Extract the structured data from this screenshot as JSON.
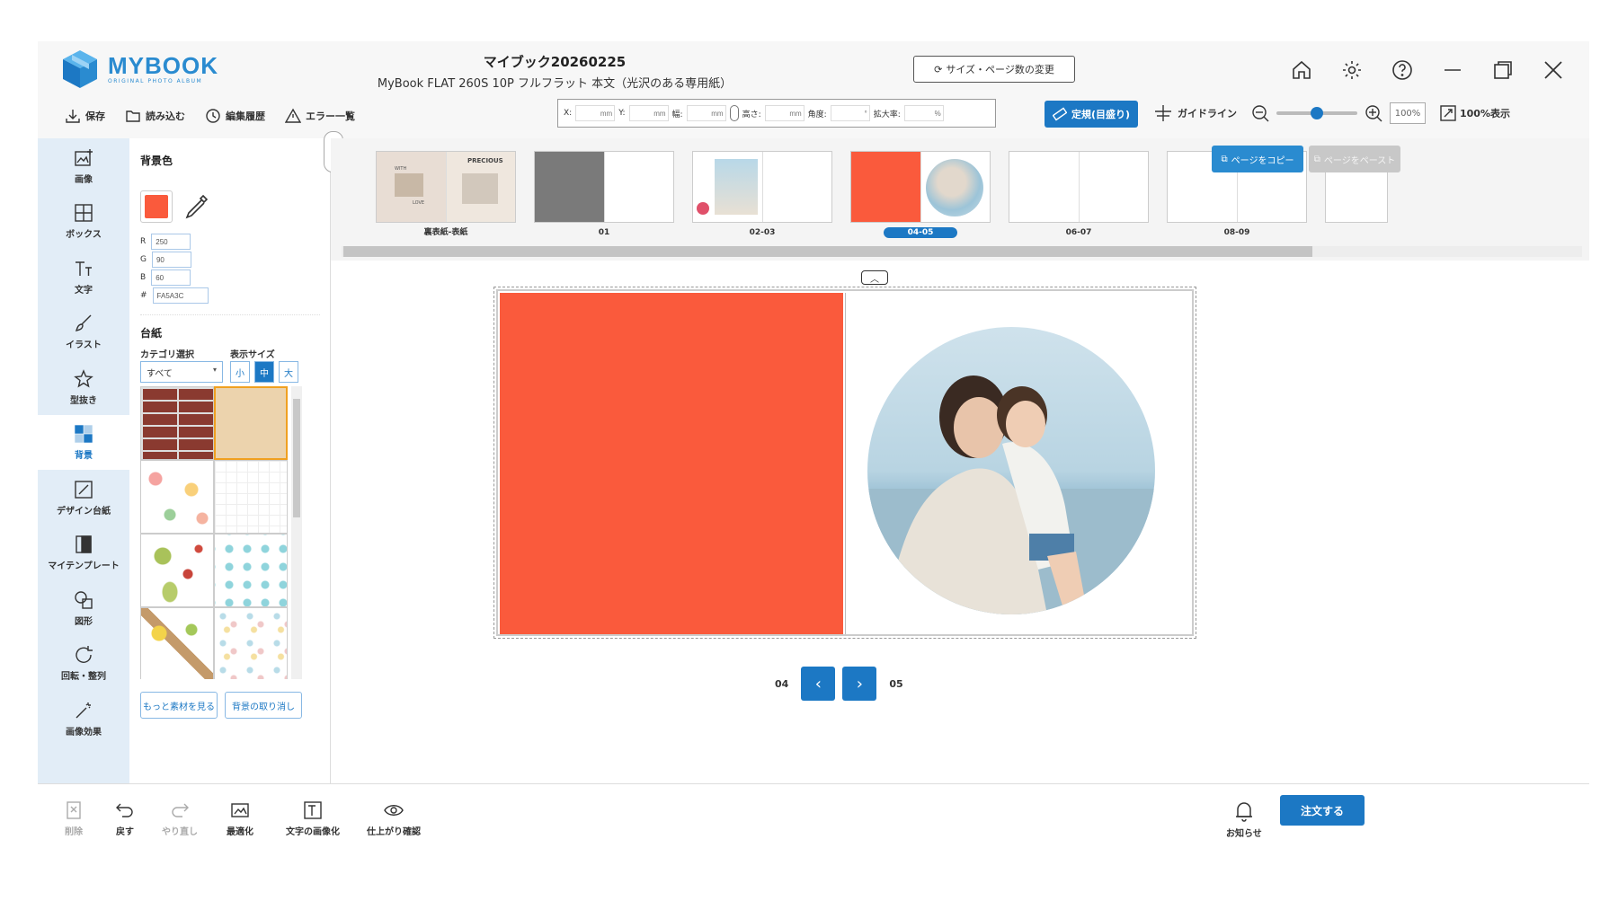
{
  "header": {
    "logo_text": "MYBOOK",
    "logo_sub": "ORIGINAL PHOTO ALBUM",
    "title": "マイブック20260225",
    "subtitle": "MyBook FLAT 260S 10P フルフラット 本文（光沢のある専用紙）",
    "size_change_label": "サイズ・ページ数の変更"
  },
  "toolbar": {
    "save": "保存",
    "load": "読み込む",
    "history": "編集履歴",
    "errors": "エラー一覧",
    "x_label": "X:",
    "y_label": "Y:",
    "w_label": "幅:",
    "h_label": "高さ:",
    "angle_label": "角度:",
    "scale_label": "拡大率:",
    "mm": "mm",
    "deg": "°",
    "pct": "%",
    "ruler": "定規(目盛り)",
    "guideline": "ガイドライン",
    "zoom_value": "100%",
    "zoom_level": 0.5,
    "zoom_100": "100%表示"
  },
  "tools": [
    {
      "label": "画像",
      "icon": "image-add-icon"
    },
    {
      "label": "ボックス",
      "icon": "box-layout-icon"
    },
    {
      "label": "文字",
      "icon": "text-icon"
    },
    {
      "label": "イラスト",
      "icon": "brush-icon"
    },
    {
      "label": "型抜き",
      "icon": "star-cutout-icon"
    },
    {
      "label": "背景",
      "icon": "background-checker-icon"
    },
    {
      "label": "デザイン台紙",
      "icon": "design-mount-icon"
    },
    {
      "label": "マイテンプレート",
      "icon": "template-icon"
    },
    {
      "label": "図形",
      "icon": "shapes-icon"
    },
    {
      "label": "回転・整列",
      "icon": "rotate-icon"
    },
    {
      "label": "画像効果",
      "icon": "magic-wand-icon"
    }
  ],
  "bg_panel": {
    "color_title": "背景色",
    "color_hex_value": "#FA5A3C",
    "r_label": "R",
    "r": "250",
    "g_label": "G",
    "g": "90",
    "b_label": "B",
    "b": "60",
    "hash_label": "#",
    "hex": "FA5A3C",
    "mount_title": "台紙",
    "category_label": "カテゴリ選択",
    "size_label": "表示サイズ",
    "category_value": "すべて",
    "size_small": "小",
    "size_medium": "中",
    "size_large": "大",
    "more_button": "もっと素材を見る",
    "cancel_bg_button": "背景の取り消し"
  },
  "pages": [
    {
      "label": "裏表紙-表紙"
    },
    {
      "label": "01"
    },
    {
      "label": "02-03"
    },
    {
      "label": "04-05",
      "active": true
    },
    {
      "label": "06-07"
    },
    {
      "label": "08-09"
    }
  ],
  "cover_text": {
    "precious": "PRECIOUS",
    "with": "WITH",
    "love": "LOVE"
  },
  "copy_page": "ページをコピー",
  "paste_page": "ページをペースト",
  "page_nav": {
    "left": "04",
    "right": "05"
  },
  "bottom": {
    "delete": "削除",
    "undo": "戻す",
    "redo": "やり直し",
    "optimize": "最適化",
    "text_to_image": "文字の画像化",
    "preview": "仕上がり確認",
    "notice": "お知らせ",
    "order": "注文する"
  },
  "colors": {
    "accent": "#1c78c4",
    "bg_red": "#FA5A3C"
  }
}
